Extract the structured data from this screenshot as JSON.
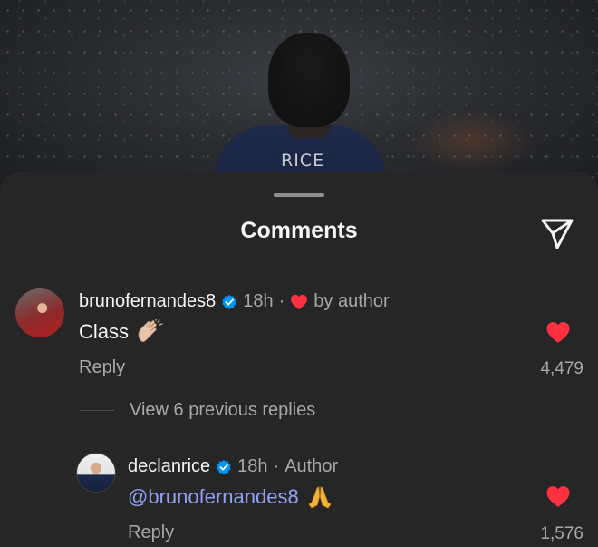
{
  "photo": {
    "jersey_name": "RICE"
  },
  "sheet": {
    "title": "Comments"
  },
  "comments": [
    {
      "username": "brunofernandes8",
      "time": "18h",
      "separator": "·",
      "liked_label": "by author",
      "text": "Class",
      "reply_label": "Reply",
      "likes": "4,479"
    }
  ],
  "view_replies": "View 6 previous replies",
  "replies": [
    {
      "username": "declanrice",
      "time": "18h",
      "separator": "·",
      "badge": "Author",
      "mention": "@brunofernandes8",
      "reply_label": "Reply",
      "likes": "1,576"
    }
  ],
  "colors": {
    "background": "#262626",
    "like_red": "#ff3040",
    "verified_blue": "#0095f6",
    "mention_blue": "#8ea3f5",
    "muted": "#a8a8a8"
  },
  "icons": [
    "share-icon",
    "verified-icon",
    "heart-icon",
    "clap-emoji",
    "pray-emoji"
  ]
}
